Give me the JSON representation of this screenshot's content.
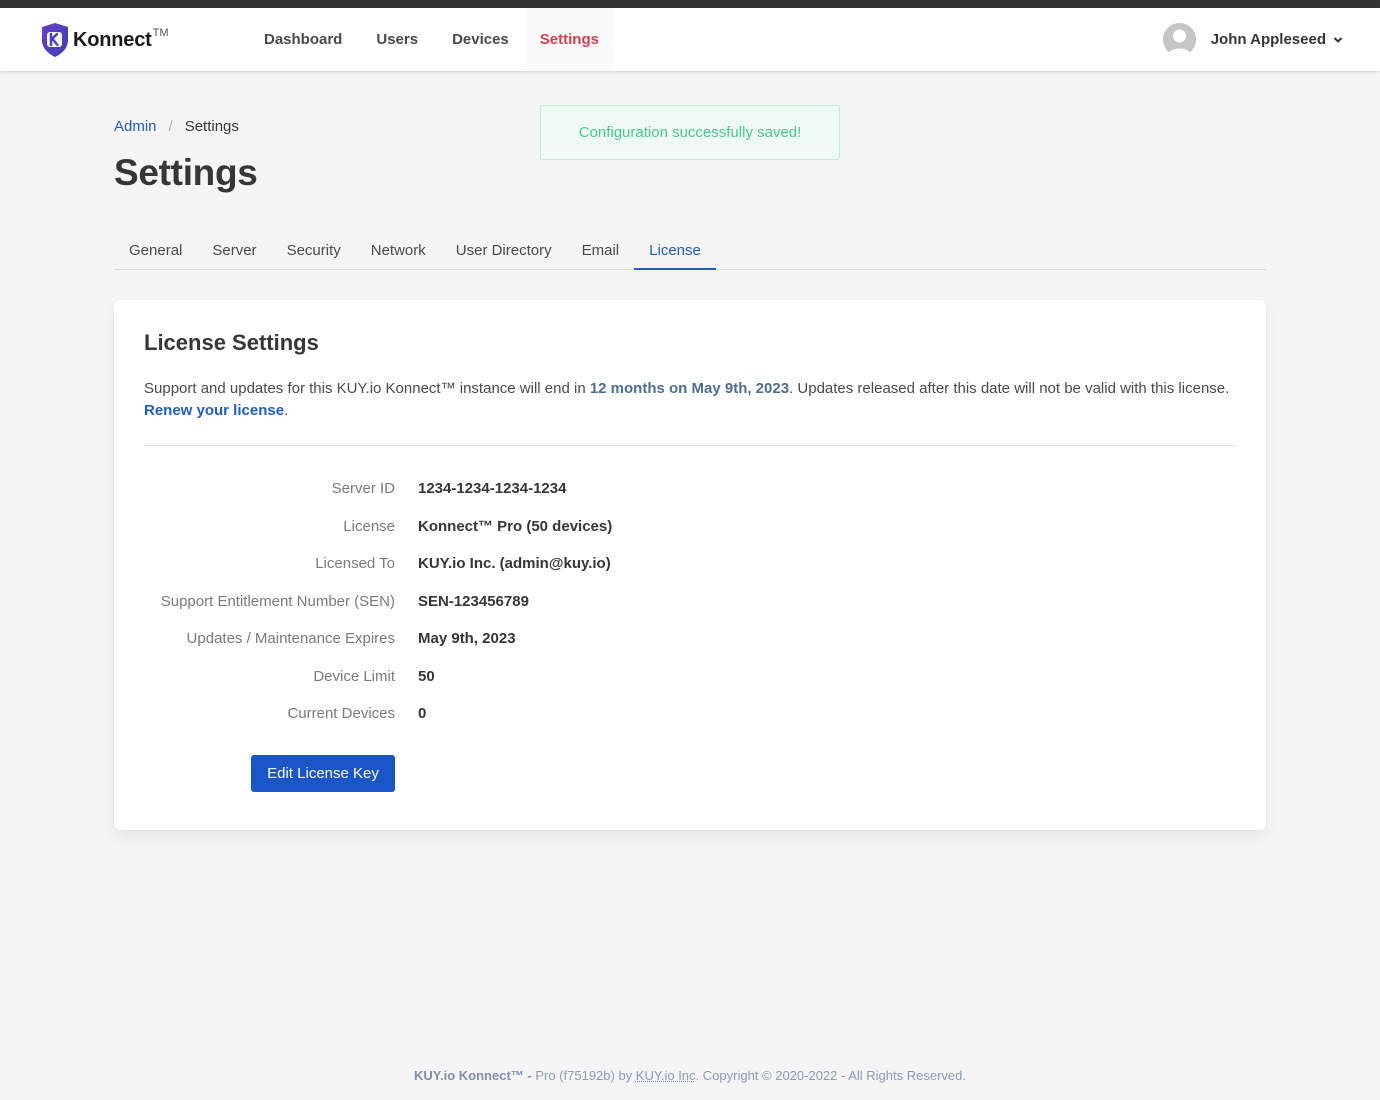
{
  "navbar": {
    "brand": "Konnect",
    "brand_tm": "TM",
    "logo_letter": "K",
    "items": [
      {
        "label": "Dashboard",
        "active": false
      },
      {
        "label": "Users",
        "active": false
      },
      {
        "label": "Devices",
        "active": false
      },
      {
        "label": "Settings",
        "active": true
      }
    ],
    "user_name": "John Appleseed",
    "user_menu_icon": "chevron-down-icon"
  },
  "notification": {
    "message": "Configuration successfully saved!",
    "color": "#48c78e"
  },
  "breadcrumb": {
    "parent": "Admin",
    "separator": "/",
    "current": "Settings"
  },
  "page_title": "Settings",
  "tabs": [
    {
      "label": "General",
      "active": false
    },
    {
      "label": "Server",
      "active": false
    },
    {
      "label": "Security",
      "active": false
    },
    {
      "label": "Network",
      "active": false
    },
    {
      "label": "User Directory",
      "active": false
    },
    {
      "label": "Email",
      "active": false
    },
    {
      "label": "License",
      "active": true
    }
  ],
  "license_card": {
    "title": "License Settings",
    "desc_prefix": "Support and updates for this KUY.io Konnect™ instance will end in ",
    "desc_highlight": "12 months on May 9th, 2023",
    "desc_middle": ". Updates released after this date will not be valid with this license. ",
    "renew_link": "Renew your license",
    "desc_suffix": ".",
    "fields": [
      {
        "label": "Server ID",
        "value": "1234-1234-1234-1234"
      },
      {
        "label": "License",
        "value": "Konnect™ Pro (50 devices)"
      },
      {
        "label": "Licensed To",
        "value": "KUY.io Inc. (admin@kuy.io)"
      },
      {
        "label": "Support Entitlement Number (SEN)",
        "value": "SEN-123456789"
      },
      {
        "label": "Updates / Maintenance Expires",
        "value": "May 9th, 2023"
      },
      {
        "label": "Device Limit",
        "value": "50"
      },
      {
        "label": "Current Devices",
        "value": "0"
      }
    ],
    "edit_button": "Edit License Key"
  },
  "footer": {
    "product": "KUY.io Konnect™ -",
    "edition": " Pro (f75192b) by ",
    "company": "KUY.io Inc",
    "copyright": ". Copyright © 2020-2022 - All Rights Reserved."
  },
  "colors": {
    "accent": "#1f5bc9",
    "active_nav": "#d2404d",
    "button": "#1a56c8",
    "success_bg": "#effaf5"
  }
}
